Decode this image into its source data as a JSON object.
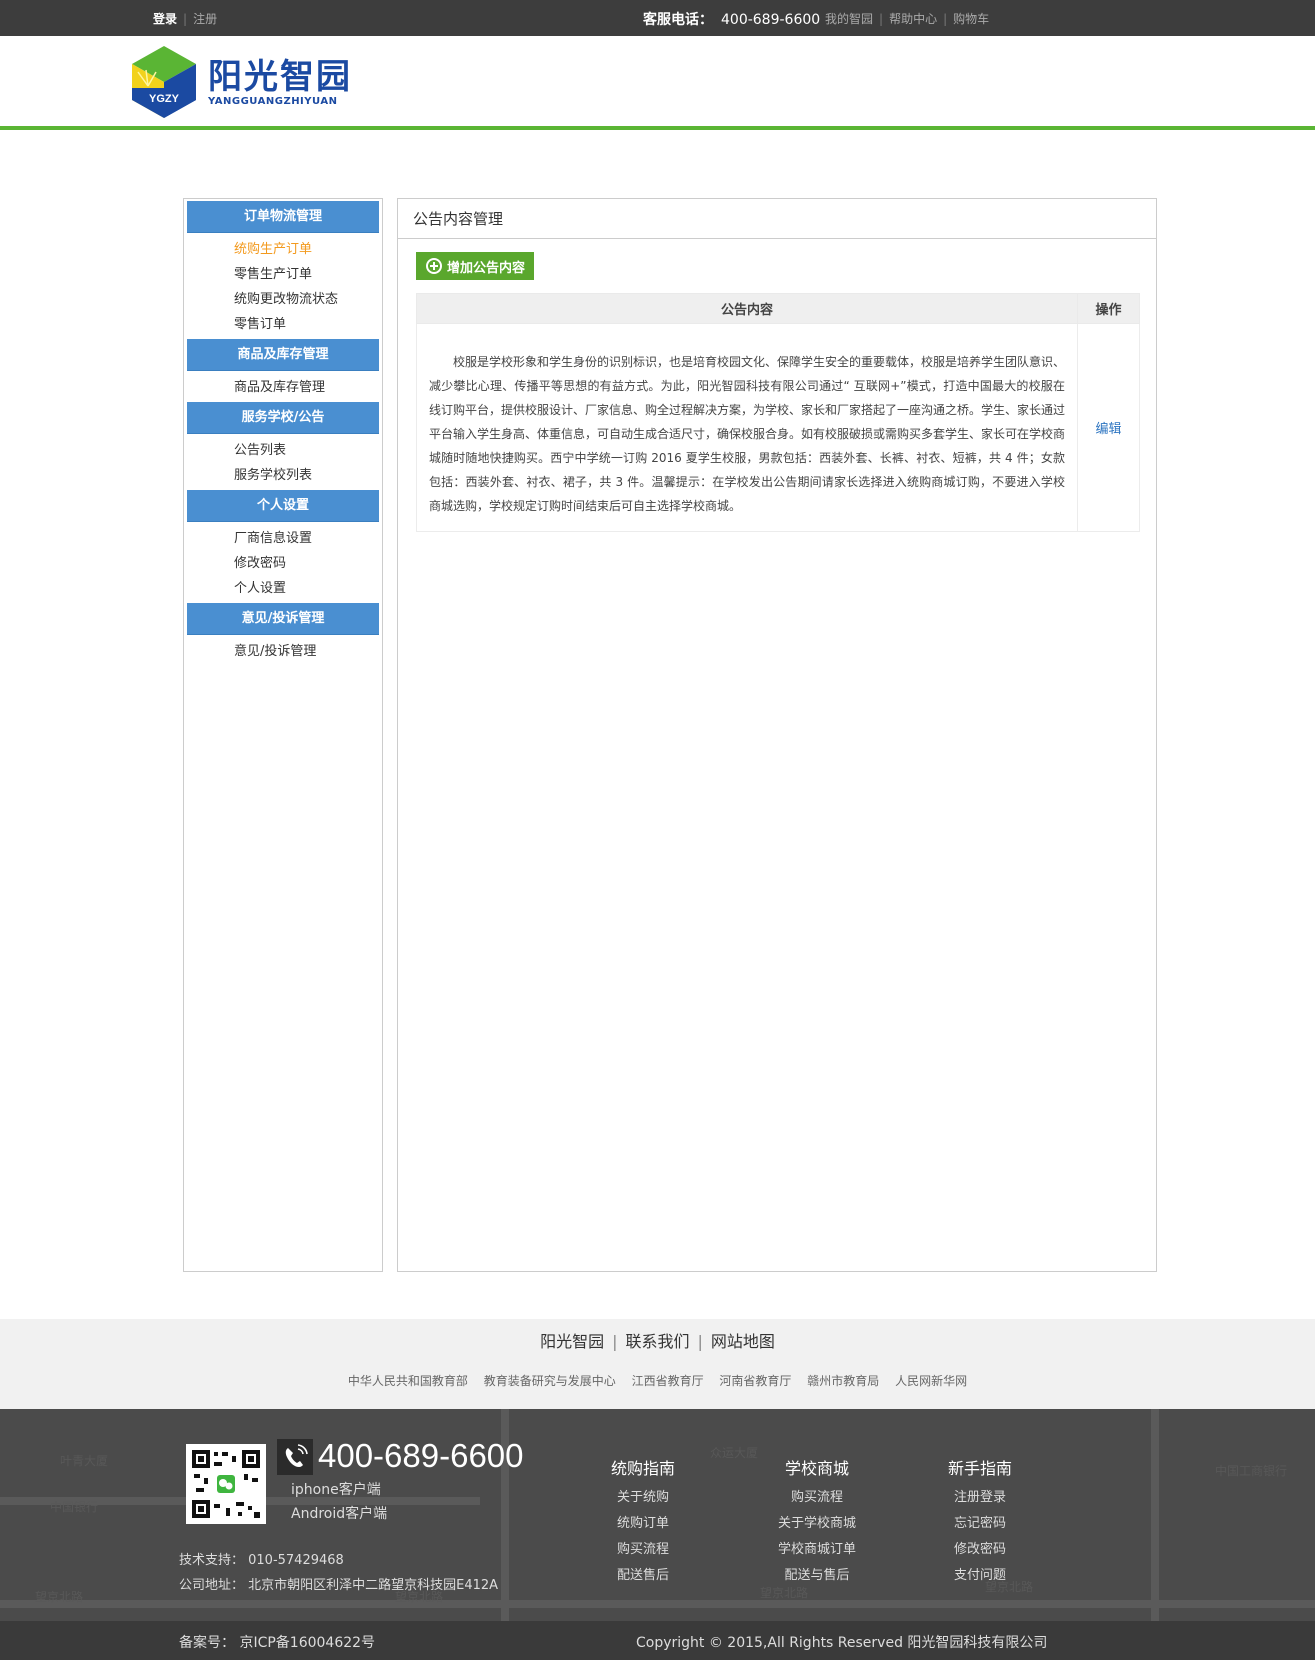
{
  "topbar": {
    "login": "登录",
    "register": "注册",
    "hotline_label": "客服电话：",
    "hotline_number": "400-689-6600",
    "links": [
      "我的智园",
      "帮助中心",
      "购物车"
    ]
  },
  "logo": {
    "cn": "阳光智园",
    "en": "YANGGUANGZHIYUAN",
    "badge": "YGZY",
    "colors": {
      "green": "#5ab534",
      "blue": "#1b4aa2"
    }
  },
  "sidebar": {
    "sections": [
      {
        "title": "订单物流管理",
        "items": [
          "统购生产订单",
          "零售生产订单",
          "统购更改物流状态",
          "零售订单"
        ]
      },
      {
        "title": "商品及库存管理",
        "items": [
          "商品及库存管理"
        ]
      },
      {
        "title": "服务学校/公告",
        "items": [
          "公告列表",
          "服务学校列表"
        ]
      },
      {
        "title": "个人设置",
        "items": [
          "厂商信息设置",
          "修改密码",
          "个人设置"
        ]
      },
      {
        "title": "意见/投诉管理",
        "items": [
          "意见/投诉管理"
        ]
      }
    ],
    "active_item": "统购生产订单",
    "accent": "#4a8fd1",
    "active_color": "#f39a1e"
  },
  "main": {
    "title": "公告内容管理",
    "add_button": "增加公告内容",
    "table": {
      "headers": [
        "公告内容",
        "操作"
      ],
      "rows": [
        {
          "content": "校服是学校形象和学生身份的识别标识，也是培育校园文化、保障学生安全的重要载体，校服是培养学生团队意识、减少攀比心理、传播平等思想的有益方式。为此，阳光智园科技有限公司通过“ 互联网+”模式，打造中国最大的校服在线订购平台，提供校服设计、厂家信息、购全过程解决方案，为学校、家长和厂家搭起了一座沟通之桥。学生、家长通过平台输入学生身高、体重信息，可自动生成合适尺寸，确保校服合身。如有校服破损或需购买多套学生、家长可在学校商城随时随地快捷购买。西宁中学统一订购 2016 夏学生校服，男款包括：西装外套、长裤、衬衣、短裤，共 4 件；女款包括：西装外套、衬衣、裙子，共 3 件。温馨提示：在学校发出公告期间请家长选择进入统购商城订购，不要进入学校商城选购，学校规定订购时间结束后可自主选择学校商城。",
          "action": "编辑"
        }
      ]
    }
  },
  "footer": {
    "main_links": [
      "阳光智园",
      "联系我们",
      "网站地图"
    ],
    "partner_links": [
      "中华人民共和国教育部",
      "教育装备研究与发展中心",
      "江西省教育厅",
      "河南省教育厅",
      "赣州市教育局",
      "人民网新华网"
    ],
    "phone": "400-689-6600",
    "clients": [
      "iphone客户端",
      "Android客户端"
    ],
    "tech_support": "技术支持：  010-57429468",
    "address": "公司地址：  北京市朝阳区利泽中二路望京科技园E412A",
    "columns": [
      {
        "title": "统购指南",
        "items": [
          "关于统购",
          "统购订单",
          "购买流程",
          "配送售后"
        ]
      },
      {
        "title": "学校商城",
        "items": [
          "购买流程",
          "关于学校商城",
          "学校商城订单",
          "配送与售后"
        ]
      },
      {
        "title": "新手指南",
        "items": [
          "注册登录",
          "忘记密码",
          "修改密码",
          "支付问题"
        ]
      }
    ],
    "icp": "备案号：  京ICP备16004622号",
    "copyright": "Copyright © 2015,All Rights Reserved 阳光智园科技有限公司"
  }
}
